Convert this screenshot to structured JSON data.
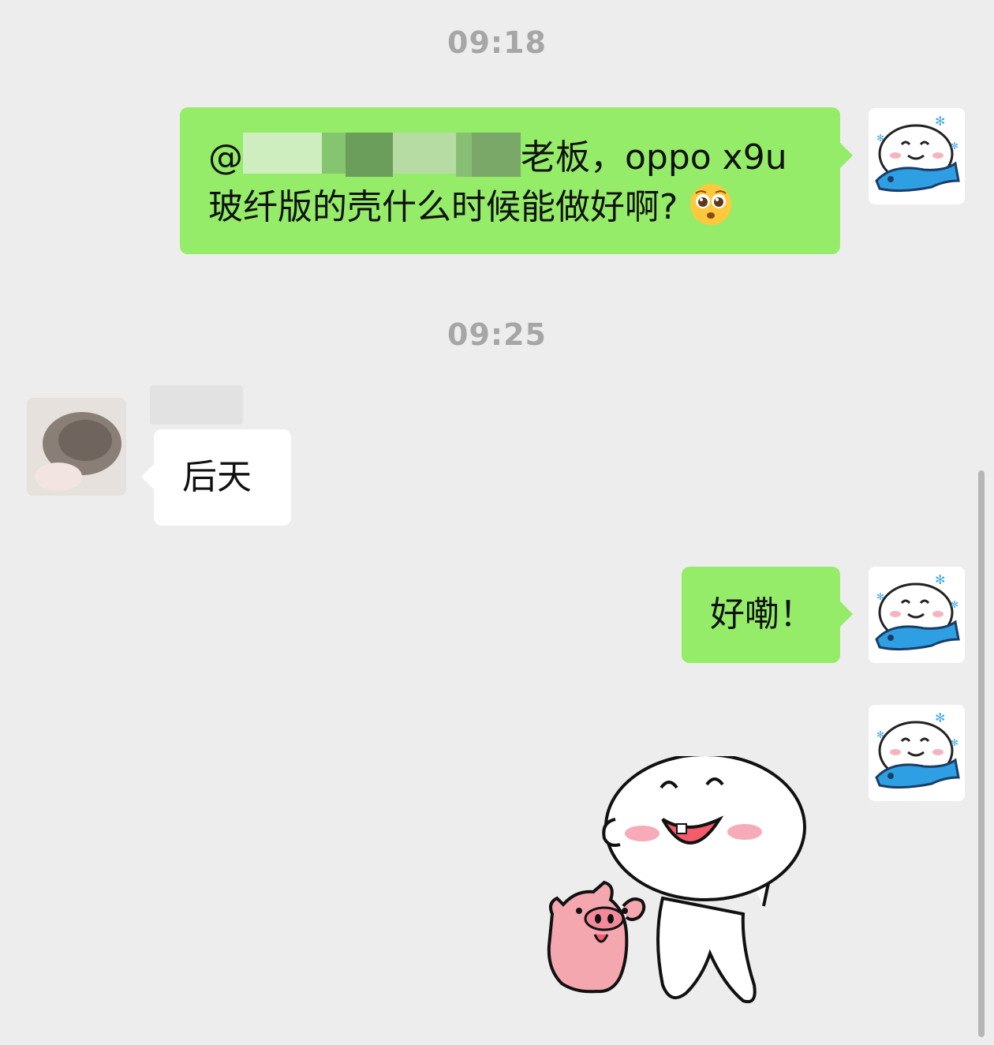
{
  "messages": {
    "timestamp_1": "09:18",
    "msg1": {
      "prefix": "@",
      "line1_suffix": "老板，oppo x9u",
      "line2": "玻纤版的壳什么时候能做好啊?",
      "emoji": "pleading-face-icon"
    },
    "timestamp_2": "09:25",
    "msg2": {
      "text": "后天"
    },
    "msg3": {
      "text": "好嘞！"
    },
    "sticker": {
      "name": "dumpling-and-pig-sticker"
    }
  },
  "colors": {
    "background": "#ededed",
    "sent_bubble": "#95ec69",
    "received_bubble": "#ffffff",
    "timestamp": "#a6a6a6"
  }
}
